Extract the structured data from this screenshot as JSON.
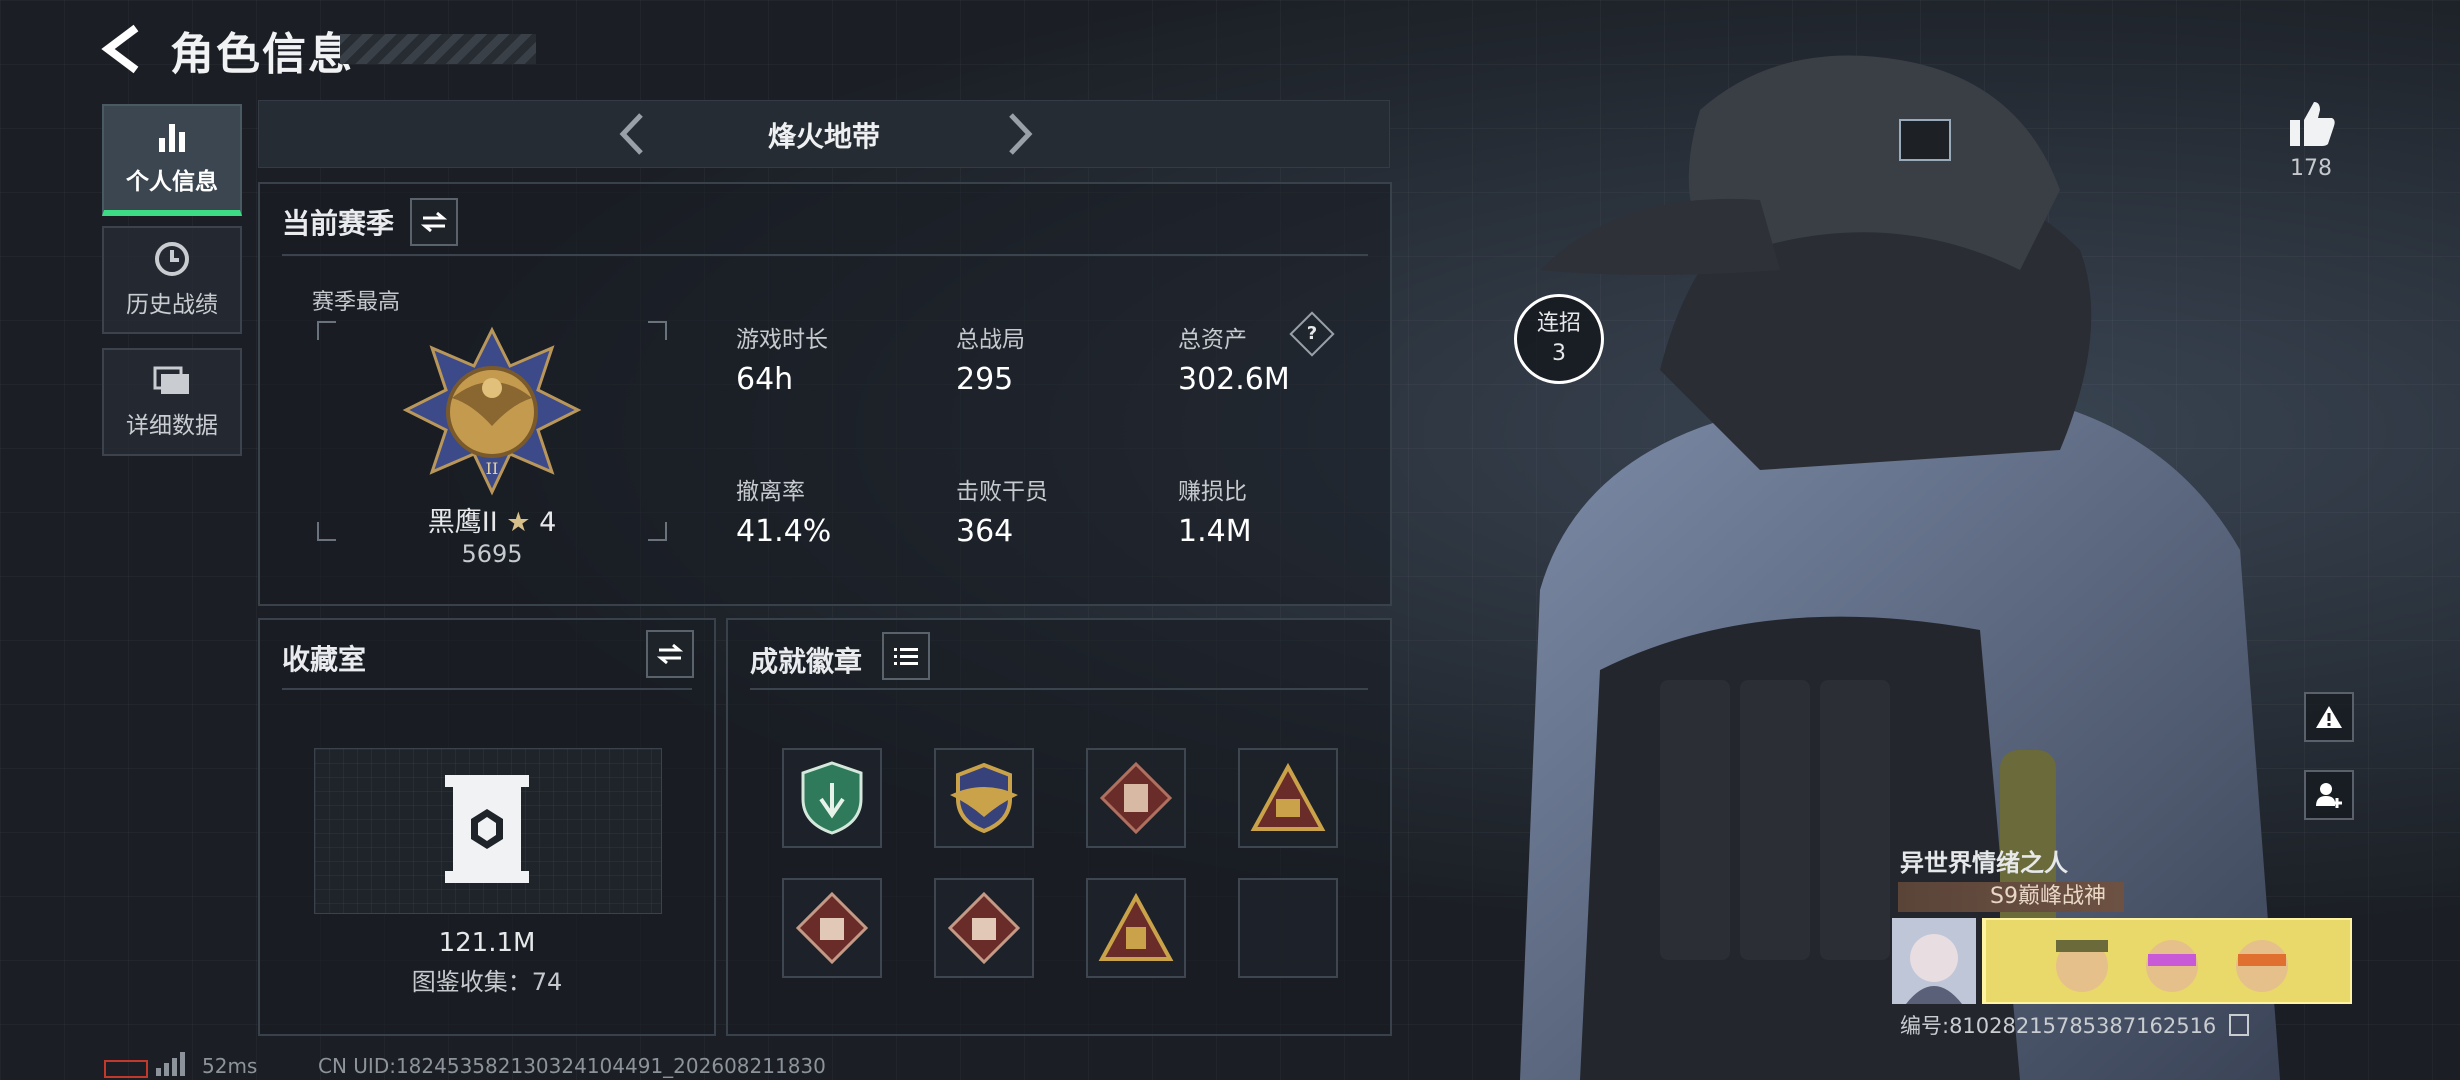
{
  "header": {
    "title": "角色信息"
  },
  "nav": [
    {
      "label": "个人信息",
      "icon": "bar-chart-icon",
      "active": true
    },
    {
      "label": "历史战绩",
      "icon": "clock-icon",
      "active": false
    },
    {
      "label": "详细数据",
      "icon": "folders-icon",
      "active": false
    }
  ],
  "mode": {
    "title": "烽火地带"
  },
  "season": {
    "title": "当前赛季",
    "highest_label": "赛季最高",
    "rank_name": "黑鹰II",
    "rank_stars": "4",
    "rank_score": "5695",
    "stats": [
      {
        "label": "游戏时长",
        "value": "64h"
      },
      {
        "label": "总战局",
        "value": "295"
      },
      {
        "label": "总资产",
        "value": "302.6M",
        "has_help": true
      },
      {
        "label": "撤离率",
        "value": "41.4%"
      },
      {
        "label": "击败干员",
        "value": "364"
      },
      {
        "label": "赚损比",
        "value": "1.4M"
      }
    ],
    "help_mark": "?"
  },
  "collection": {
    "title": "收藏室",
    "value": "121.1M",
    "index_label": "图鉴收集：74"
  },
  "achievements": {
    "title": "成就徽章",
    "badges": [
      "green-shield-badge",
      "gold-wings-badge",
      "red-vest-badge",
      "gold-triangle-badge",
      "red-diamond-badge",
      "red-diamond-badge-2",
      "gold-triangle-badge-2",
      "empty"
    ]
  },
  "profile": {
    "likes": "178",
    "combo_label": "连招",
    "combo_value": "3",
    "player_name": "异世界情绪之人",
    "player_title": "S9巅峰战神",
    "player_id": "编号:81028215785387162516"
  },
  "footer": {
    "ping": "52ms",
    "uid": "CN UID:18245358213032410449­1_202608211830"
  },
  "colors": {
    "accent": "#3ddc84",
    "gold": "#c9a24a",
    "panel_border": "#39414a"
  }
}
